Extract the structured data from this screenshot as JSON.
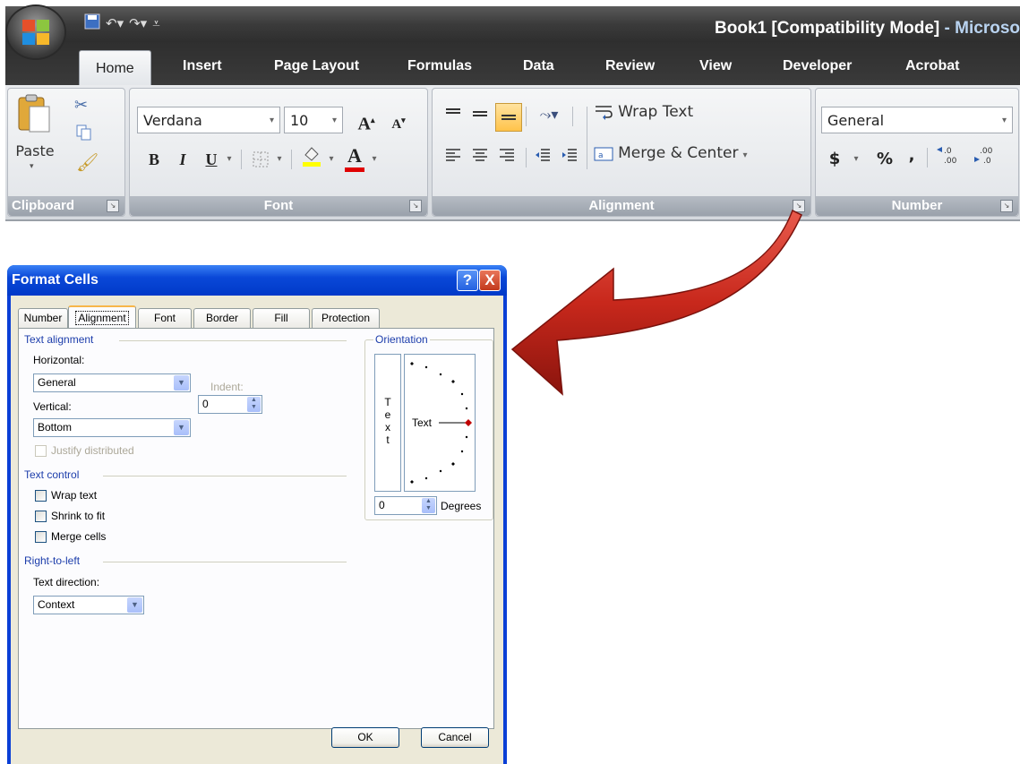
{
  "ribbon": {
    "title_main": "Book1  [Compatibility Mode]",
    "title_suffix": " - Microso",
    "tabs": [
      "Home",
      "Insert",
      "Page Layout",
      "Formulas",
      "Data",
      "Review",
      "View",
      "Developer",
      "Acrobat"
    ],
    "active_tab": "Home",
    "clipboard": {
      "paste_label": "Paste",
      "group_label": "Clipboard"
    },
    "font": {
      "font_name": "Verdana",
      "font_size": "10",
      "group_label": "Font",
      "bold": "B",
      "italic": "I",
      "underline": "U",
      "grow": "A",
      "shrink": "A",
      "font_color": "A"
    },
    "alignment": {
      "wrap_text": "Wrap Text",
      "merge_center": "Merge & Center",
      "group_label": "Alignment"
    },
    "number": {
      "format": "General",
      "currency": "$",
      "percent": "%",
      "comma": ",",
      "group_label": "Number"
    }
  },
  "dialog": {
    "title": "Format Cells",
    "help_label": "?",
    "close_label": "X",
    "tabs": [
      "Number",
      "Alignment",
      "Font",
      "Border",
      "Fill",
      "Protection"
    ],
    "selected_tab": "Alignment",
    "text_alignment": {
      "section": "Text alignment",
      "horizontal_label": "Horizontal:",
      "horizontal_value": "General",
      "indent_label": "Indent:",
      "indent_value": "0",
      "vertical_label": "Vertical:",
      "vertical_value": "Bottom",
      "justify_distributed": "Justify distributed"
    },
    "text_control": {
      "section": "Text control",
      "wrap_text": "Wrap text",
      "shrink_to_fit": "Shrink to fit",
      "merge_cells": "Merge cells"
    },
    "right_to_left": {
      "section": "Right-to-left",
      "text_direction_label": "Text direction:",
      "text_direction_value": "Context"
    },
    "orientation": {
      "section": "Orientation",
      "vertical_text": [
        "T",
        "e",
        "x",
        "t"
      ],
      "dial_text": "Text",
      "degrees_value": "0",
      "degrees_label": "Degrees"
    },
    "ok_label": "OK",
    "cancel_label": "Cancel"
  },
  "colors": {
    "arrow": "#c8281c",
    "dialog_title": "#0a48d8",
    "ribbon_title": "#3b3b3b"
  }
}
